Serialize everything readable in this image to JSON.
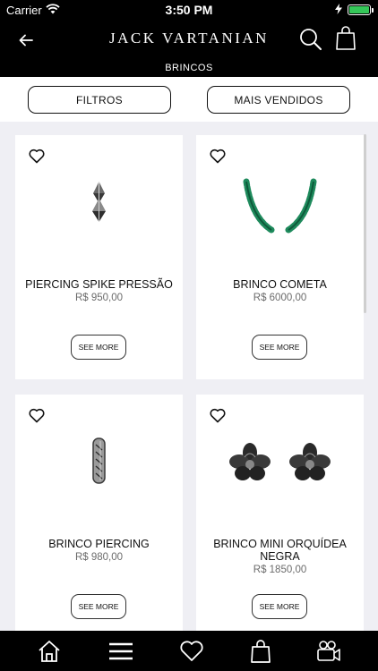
{
  "status_bar": {
    "carrier": "Carrier",
    "time": "3:50 PM",
    "battery_level": 1.0,
    "battery_color": "#35c759"
  },
  "nav": {
    "brand": "JACK VARTANIAN",
    "subtitle": "BRINCOS",
    "back_icon": "back-arrow-icon",
    "search_icon": "search-icon",
    "bag_icon": "shopping-bag-icon"
  },
  "filters": {
    "filter_label": "FILTROS",
    "sort_label": "MAIS VENDIDOS"
  },
  "products": [
    {
      "name": "PIERCING SPIKE PRESSÃO",
      "price": "R$ 950,00",
      "button": "SEE MORE",
      "image_icon": "spike-piercing-image"
    },
    {
      "name": "BRINCO COMETA",
      "price": "R$ 6000,00",
      "button": "SEE MORE",
      "image_icon": "comet-earring-image"
    },
    {
      "name": "BRINCO PIERCING",
      "price": "R$ 980,00",
      "button": "SEE MORE",
      "image_icon": "piercing-earring-image"
    },
    {
      "name": "BRINCO MINI ORQUÍDEA NEGRA",
      "price": "R$ 1850,00",
      "button": "SEE MORE",
      "image_icon": "orchid-earring-image"
    }
  ],
  "tab_bar": {
    "items": [
      "home-icon",
      "menu-icon",
      "heart-icon",
      "bag-icon",
      "video-camera-icon"
    ]
  },
  "colors": {
    "header_bg": "#000000",
    "page_bg": "#efeff4",
    "accent_green": "#1e8a5c"
  }
}
